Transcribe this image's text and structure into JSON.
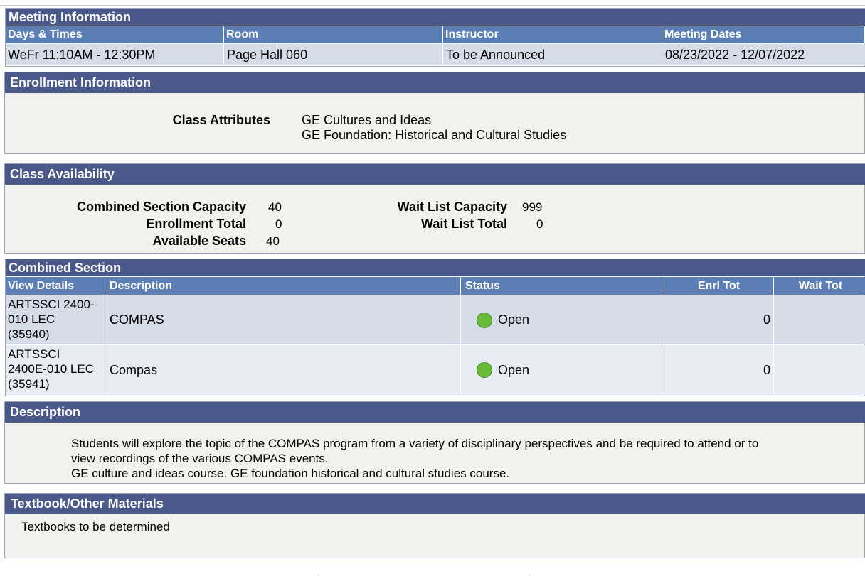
{
  "meeting": {
    "title": "Meeting Information",
    "columns": [
      "Days & Times",
      "Room",
      "Instructor",
      "Meeting Dates"
    ],
    "row": [
      "WeFr 11:10AM - 12:30PM",
      "Page Hall 060",
      "To be Announced",
      "08/23/2022 - 12/07/2022"
    ]
  },
  "enrollment": {
    "title": "Enrollment Information",
    "attributes_label": "Class Attributes",
    "attributes": [
      "GE Cultures and Ideas",
      "GE Foundation: Historical and Cultural Studies"
    ]
  },
  "availability": {
    "title": "Class Availability",
    "capacity_label": "Combined Section Capacity",
    "capacity": "40",
    "enroll_total_label": "Enrollment Total",
    "enroll_total": "0",
    "available_label": "Available Seats",
    "available": "40",
    "waitlist_cap_label": "Wait List Capacity",
    "waitlist_cap": "999",
    "waitlist_total_label": "Wait List Total",
    "waitlist_total": "0"
  },
  "combined": {
    "title": "Combined Section",
    "columns": [
      "View Details",
      "Description",
      "Status",
      "Enrl Tot",
      "Wait Tot"
    ],
    "rows": [
      {
        "details": [
          "ARTSSCI 2400-",
          "010 LEC",
          "(35940)"
        ],
        "description": "COMPAS",
        "status": "Open",
        "enrl": "0"
      },
      {
        "details": [
          "ARTSSCI",
          "2400E-010 LEC",
          "(35941)"
        ],
        "description": "Compas",
        "status": "Open",
        "enrl": "0"
      }
    ]
  },
  "description": {
    "title": "Description",
    "lines": [
      "Students will explore the topic of the COMPAS program from a variety of disciplinary perspectives and be required to attend or to",
      "view recordings of the various COMPAS events.",
      "GE culture and ideas course. GE foundation historical and cultural studies course."
    ]
  },
  "textbook": {
    "title": "Textbook/Other Materials",
    "text": "Textbooks to be determined"
  },
  "colors": {
    "section_header": "#4a598a",
    "column_header": "#5b7fb5",
    "row_odd": "#d6dbe8",
    "row_even": "#e7ebf3",
    "status_open": "#6abb3a"
  }
}
